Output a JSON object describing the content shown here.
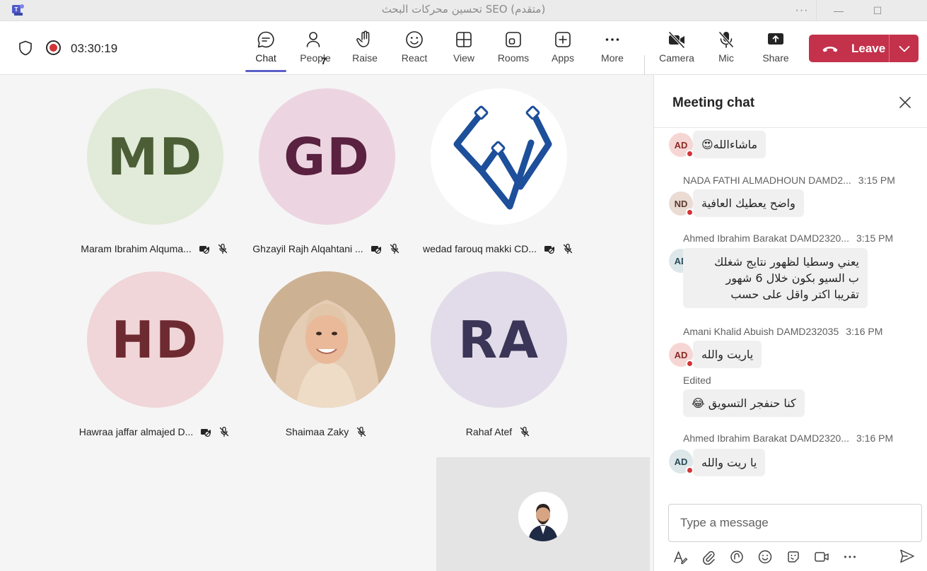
{
  "window": {
    "title": "تحسين محركات البحث SEO (متقدم)",
    "dots": "···",
    "minimize": "—",
    "maximize": "☐"
  },
  "toolbar": {
    "timer": "03:30:19",
    "people_count": "7",
    "buttons": {
      "chat": "Chat",
      "people": "People",
      "raise": "Raise",
      "react": "React",
      "view": "View",
      "rooms": "Rooms",
      "apps": "Apps",
      "more": "More",
      "camera": "Camera",
      "mic": "Mic",
      "share": "Share"
    },
    "leave_label": "Leave"
  },
  "participants": [
    {
      "initials": "MD",
      "name": "Maram Ibrahim Alquma...",
      "bg": "#e2ead9",
      "fg": "#4b5e35"
    },
    {
      "initials": "GD",
      "name": "Ghzayil Rajh Alqahtani ...",
      "bg": "#ecd5e1",
      "fg": "#5a2140"
    },
    {
      "initials": "",
      "name": "wedad farouq makki CD...",
      "bg": "#ffffff",
      "fg": "#1f4e9a"
    },
    {
      "initials": "HD",
      "name": "Hawraa jaffar almajed D...",
      "bg": "#f0d6d8",
      "fg": "#6e2a31"
    },
    {
      "initials": "",
      "name": "Shaimaa Zaky",
      "bg": "#d8c1a8",
      "fg": "#000000"
    },
    {
      "initials": "RA",
      "name": "Rahaf Atef",
      "bg": "#e2dcea",
      "fg": "#3b3557"
    }
  ],
  "chat": {
    "title": "Meeting chat",
    "messages": [
      {
        "avatar": "AD",
        "text": "ماشاءالله😍"
      },
      {
        "sender": "NADA FATHI ALMADHOUN DAMD2...",
        "time": "3:15 PM",
        "avatar": "ND",
        "text": "واضح يعطيك العافية"
      },
      {
        "sender": "Ahmed Ibrahim Barakat DAMD2320...",
        "time": "3:15 PM",
        "avatar": "AD",
        "lines": [
          "يعني وسطيا لظهور نتايج شغلك",
          "ب السيو بكون خلال 6 شهور",
          "تقريبا اكتر واقل على حسب"
        ]
      },
      {
        "sender": "Amani Khalid Abuish DAMD232035",
        "time": "3:16 PM",
        "avatar": "AD",
        "text": "ياريت والله"
      },
      {
        "edited": "Edited",
        "text": "كنا حنفجر التسويق 😂"
      },
      {
        "sender": "Ahmed Ibrahim Barakat DAMD2320...",
        "time": "3:16 PM",
        "avatar": "AD",
        "text": "يا ريت والله"
      }
    ],
    "composer_placeholder": "Type a message"
  },
  "colors": {
    "accent": "#5b5fc7",
    "leave": "#c4314b",
    "status_red": "#d13438"
  }
}
